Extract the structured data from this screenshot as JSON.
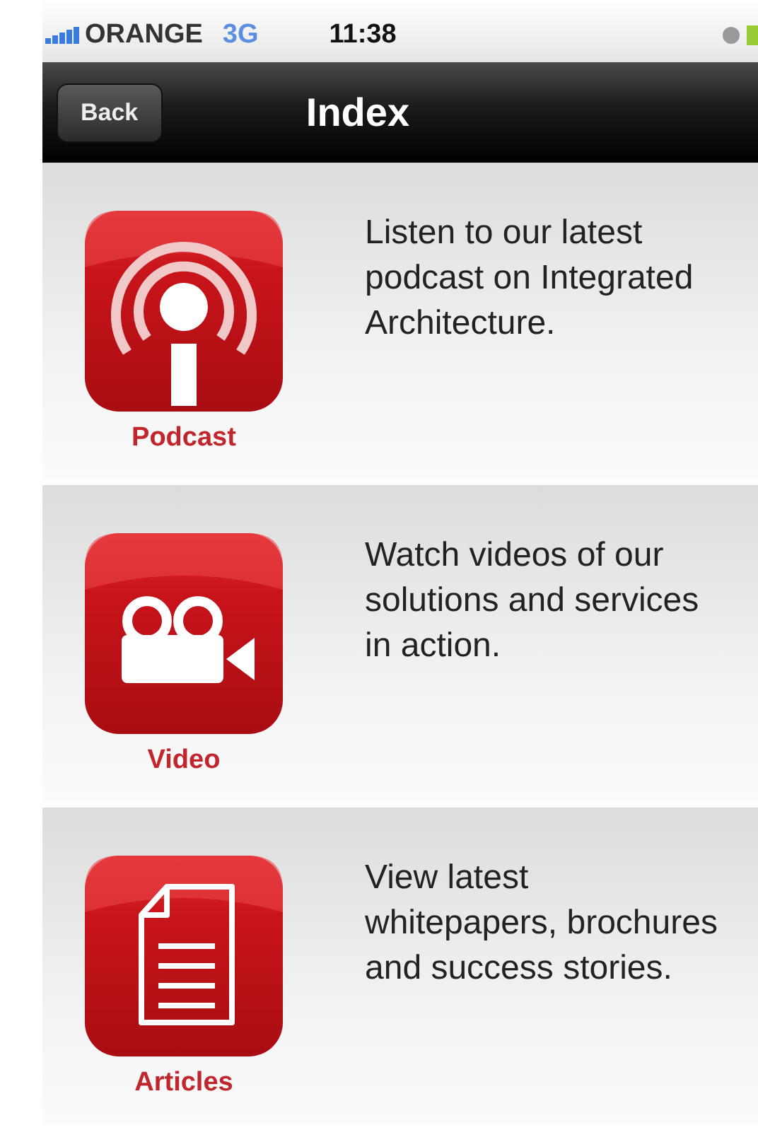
{
  "status_bar": {
    "carrier": "ORANGE",
    "network": "3G",
    "time": "11:38"
  },
  "nav_bar": {
    "back": "Back",
    "title": "Index"
  },
  "items": [
    {
      "kind": "podcast",
      "label": "Podcast",
      "description": "Listen to our latest podcast on Integrated Architecture."
    },
    {
      "kind": "video",
      "label": "Video",
      "description": "Watch videos of our solutions and services in action."
    },
    {
      "kind": "articles",
      "label": "Articles",
      "description": "View latest whitepapers, brochures and success stories."
    }
  ]
}
